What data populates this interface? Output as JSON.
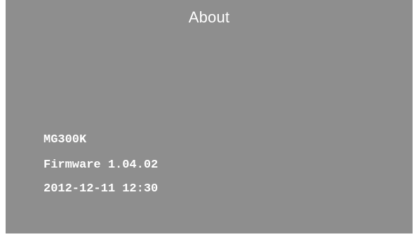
{
  "screen": {
    "title": "About",
    "info": {
      "model": "MG300K",
      "firmware": "Firmware 1.04.02",
      "datetime": "2012-12-11 12:30"
    }
  },
  "colors": {
    "background": "#8e8e8e",
    "text": "#ffffff"
  }
}
